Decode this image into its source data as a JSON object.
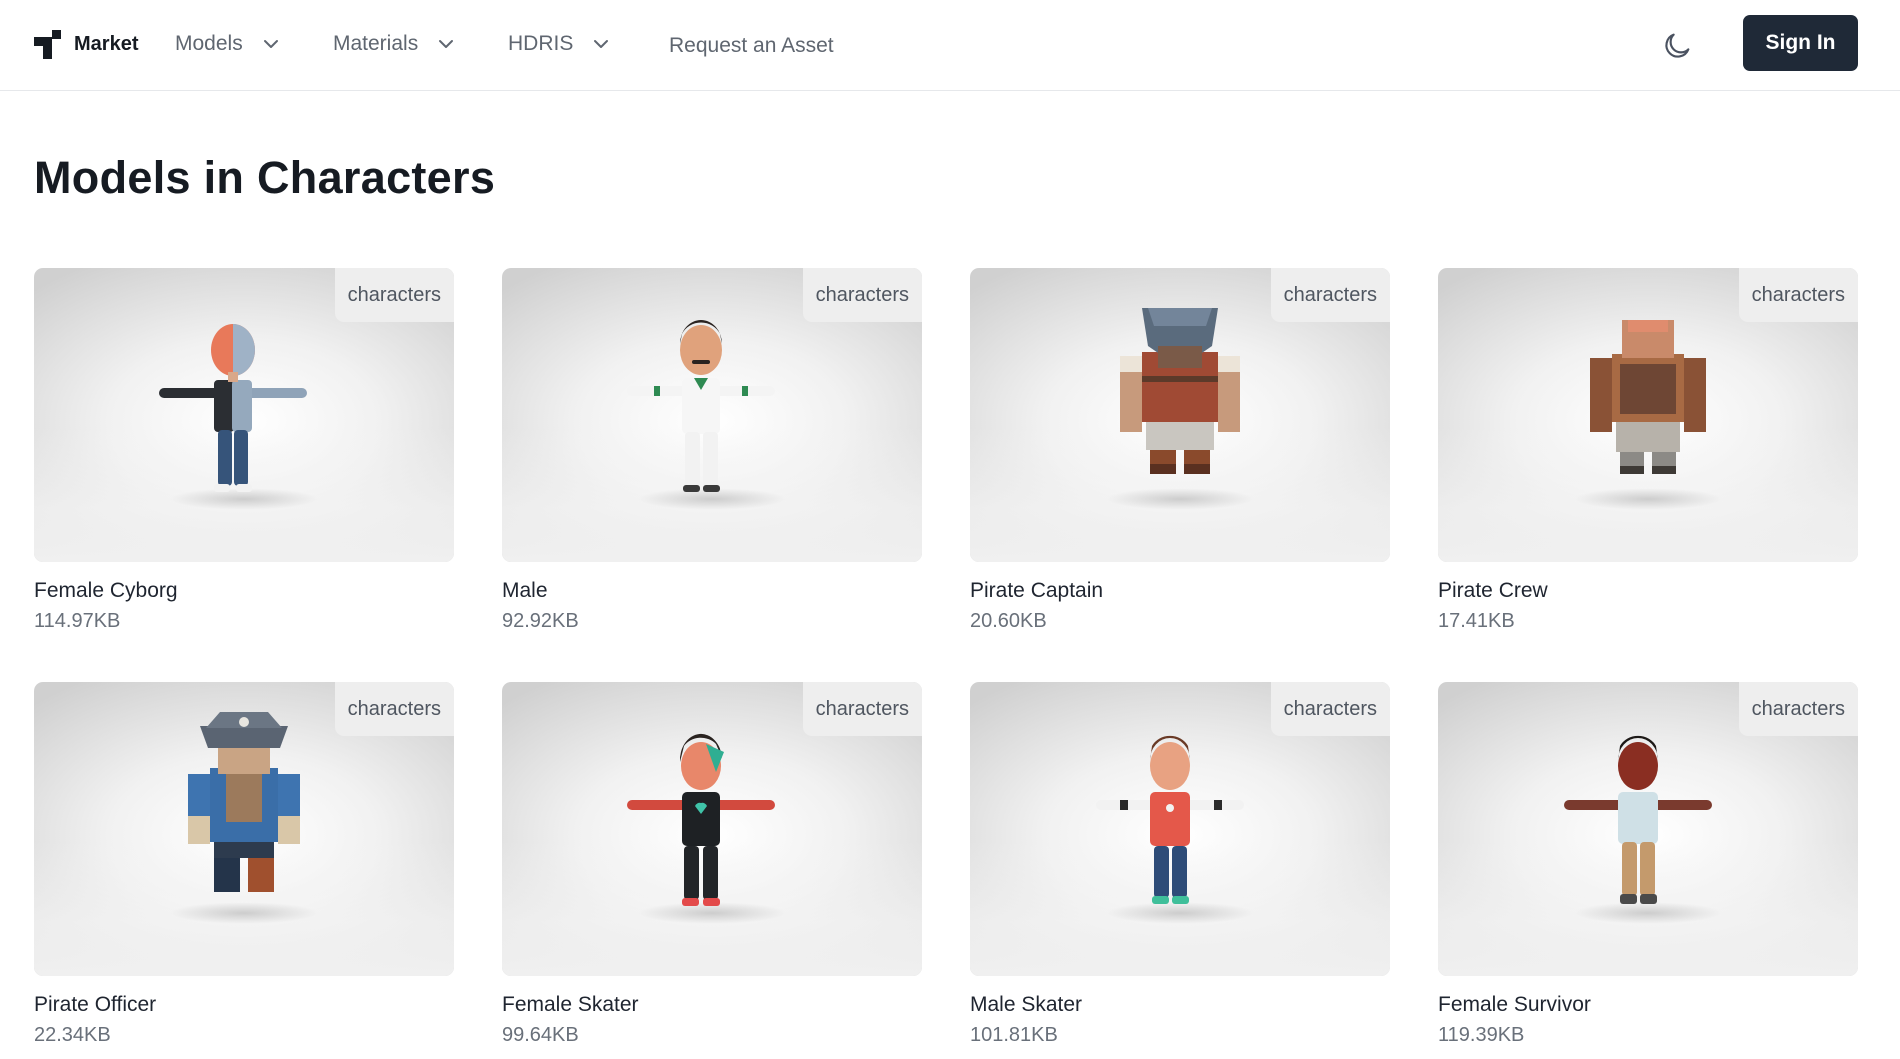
{
  "header": {
    "brand": "Market",
    "nav": [
      {
        "label": "Models"
      },
      {
        "label": "Materials"
      },
      {
        "label": "HDRIS"
      },
      {
        "label": "Request an Asset"
      }
    ],
    "signin_label": "Sign In"
  },
  "main": {
    "title": "Models in Characters",
    "cards": [
      {
        "tag": "characters",
        "name": "Female Cyborg",
        "size": "114.97KB"
      },
      {
        "tag": "characters",
        "name": "Male",
        "size": "92.92KB"
      },
      {
        "tag": "characters",
        "name": "Pirate Captain",
        "size": "20.60KB"
      },
      {
        "tag": "characters",
        "name": "Pirate Crew",
        "size": "17.41KB"
      },
      {
        "tag": "characters",
        "name": "Pirate Officer",
        "size": "22.34KB"
      },
      {
        "tag": "characters",
        "name": "Female Skater",
        "size": "99.64KB"
      },
      {
        "tag": "characters",
        "name": "Male Skater",
        "size": "101.81KB"
      },
      {
        "tag": "characters",
        "name": "Female Survivor",
        "size": "119.39KB"
      }
    ]
  },
  "icons": {
    "logo": "market-logo-icon",
    "chevron": "chevron-down-icon",
    "theme": "moon-icon"
  },
  "colors": {
    "primary_button": "#1f2937",
    "text_dark": "#161b22",
    "text_muted": "#69707a",
    "tag_bg": "#eeeeee"
  }
}
